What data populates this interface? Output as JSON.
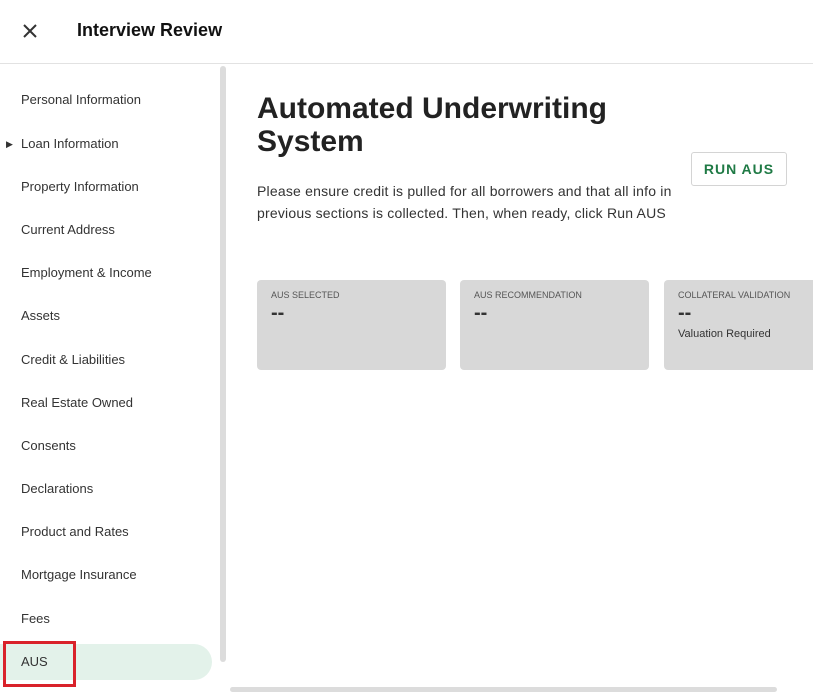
{
  "header": {
    "title": "Interview Review"
  },
  "sidebar": {
    "items": [
      {
        "label": "Personal Information"
      },
      {
        "label": "Loan Information",
        "expandable": true
      },
      {
        "label": "Property Information"
      },
      {
        "label": "Current Address"
      },
      {
        "label": "Employment & Income"
      },
      {
        "label": "Assets"
      },
      {
        "label": "Credit & Liabilities"
      },
      {
        "label": "Real Estate Owned"
      },
      {
        "label": "Consents"
      },
      {
        "label": "Declarations"
      },
      {
        "label": "Product and Rates"
      },
      {
        "label": "Mortgage Insurance"
      },
      {
        "label": "Fees"
      },
      {
        "label": "AUS",
        "active": true
      }
    ]
  },
  "main": {
    "title": "Automated Underwriting System",
    "run_button": "RUN AUS",
    "description": "Please ensure credit is pulled for all borrowers and that all info in previous sections is collected. Then, when ready, click Run AUS",
    "cards": [
      {
        "label": "AUS SELECTED",
        "value": "--"
      },
      {
        "label": "AUS RECOMMENDATION",
        "value": "--"
      },
      {
        "label": "COLLATERAL VALIDATION",
        "value": "--",
        "note": "Valuation Required"
      }
    ]
  },
  "colors": {
    "accent_green": "#1f7a45",
    "active_bg": "#e3f2ea",
    "highlight_red": "#d9222a",
    "card_bg": "#d8d8d8"
  }
}
